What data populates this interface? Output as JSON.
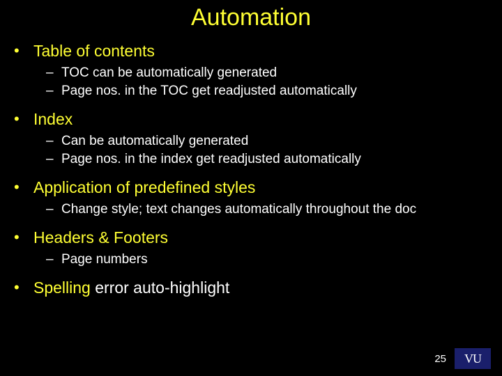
{
  "title": "Automation",
  "bullets": {
    "toc": {
      "label": "Table of contents",
      "items": [
        "TOC can be automatically generated",
        "Page nos. in the TOC get readjusted automatically"
      ]
    },
    "index": {
      "label": "Index",
      "items": [
        "Can be automatically generated",
        "Page nos. in the index get readjusted automatically"
      ]
    },
    "styles": {
      "label": "Application of predefined styles",
      "items": [
        "Change style; text changes automatically throughout the doc"
      ]
    },
    "headers": {
      "label": "Headers & Footers",
      "items": [
        "Page numbers"
      ]
    },
    "spell": {
      "part1": "Spelling",
      "part2": " error auto-highlight"
    }
  },
  "page_number": "25",
  "logo_text": "VU"
}
